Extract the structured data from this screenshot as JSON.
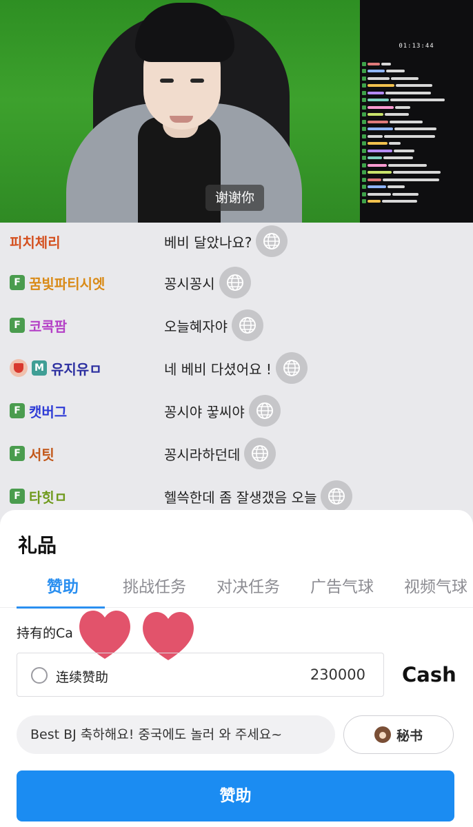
{
  "stream": {
    "subtitle": "谢谢你",
    "clock": "01:13:44"
  },
  "chat": [
    {
      "name": "피치체리",
      "color": "#d4501f",
      "badges": [],
      "message": "베비 달았나요?"
    },
    {
      "name": "꿈빛파티시엣",
      "color": "#d98a16",
      "badges": [
        "F"
      ],
      "message": "꽁시꽁시"
    },
    {
      "name": "코콕팜",
      "color": "#b43fc6",
      "badges": [
        "F"
      ],
      "message": "오늘혜자야"
    },
    {
      "name": "유지유ㅁ",
      "color": "#2c2fa0",
      "badges": [
        "vip",
        "M"
      ],
      "message": "네 베비 다셨어요 !"
    },
    {
      "name": "캣버그",
      "color": "#2e3bd6",
      "badges": [
        "F"
      ],
      "message": "꽁시야 꿓씨야"
    },
    {
      "name": "서팃",
      "color": "#c2581a",
      "badges": [
        "F"
      ],
      "message": "꽁시라하던데"
    },
    {
      "name": "타힛ㅁ",
      "color": "#6f9a1c",
      "badges": [
        "F"
      ],
      "message": "헬쓱한데 좀 잘생갰음 오늘"
    }
  ],
  "icons": {
    "translate": "globe-icon",
    "secretary": "secretary-avatar-icon",
    "sticker": "heart-icon"
  },
  "gift_panel": {
    "title": "礼品",
    "tabs": [
      "赞助",
      "挑战任务",
      "对决任务",
      "广告气球",
      "视频气球"
    ],
    "active_tab": 0,
    "owned_label": "持有的Ca",
    "continuous_label": "连续赞助",
    "amount": "230000",
    "currency": "Cash",
    "message_text": "Best BJ 축하해요! 중국에도 놀러 와 주세요~",
    "secretary_label": "秘书",
    "sponsor_button": "赞助"
  },
  "colors": {
    "accent": "#1b8cf2",
    "active_tab": "#2a8ff0",
    "heart": "#e2536b"
  }
}
